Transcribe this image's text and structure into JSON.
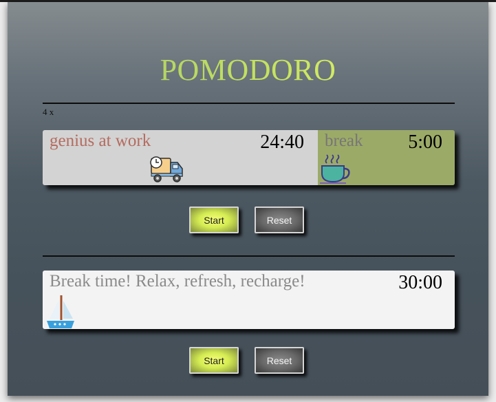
{
  "app": {
    "title": "POMODORO"
  },
  "session": {
    "count_label": "4 x"
  },
  "timer": {
    "work_label": "genius at work",
    "work_time": "24:40",
    "work_icon": "delivery-truck-icon",
    "break_label": "break",
    "break_time": "5:00",
    "break_icon": "coffee-cup-icon",
    "start_label": "Start",
    "reset_label": "Reset"
  },
  "long_break": {
    "label": "Break time! Relax, refresh, recharge!",
    "time": "30:00",
    "icon": "sailboat-icon",
    "start_label": "Start",
    "reset_label": "Reset"
  },
  "colors": {
    "work_bg": "#d3d3d3",
    "break_bg": "#9caa68",
    "long_bg": "#f3f3f3",
    "title_gradient_start": "#9cc26b",
    "title_gradient_end": "#ebff6e",
    "start_button": "#d5ec53",
    "reset_button": "#6a6a6a"
  }
}
